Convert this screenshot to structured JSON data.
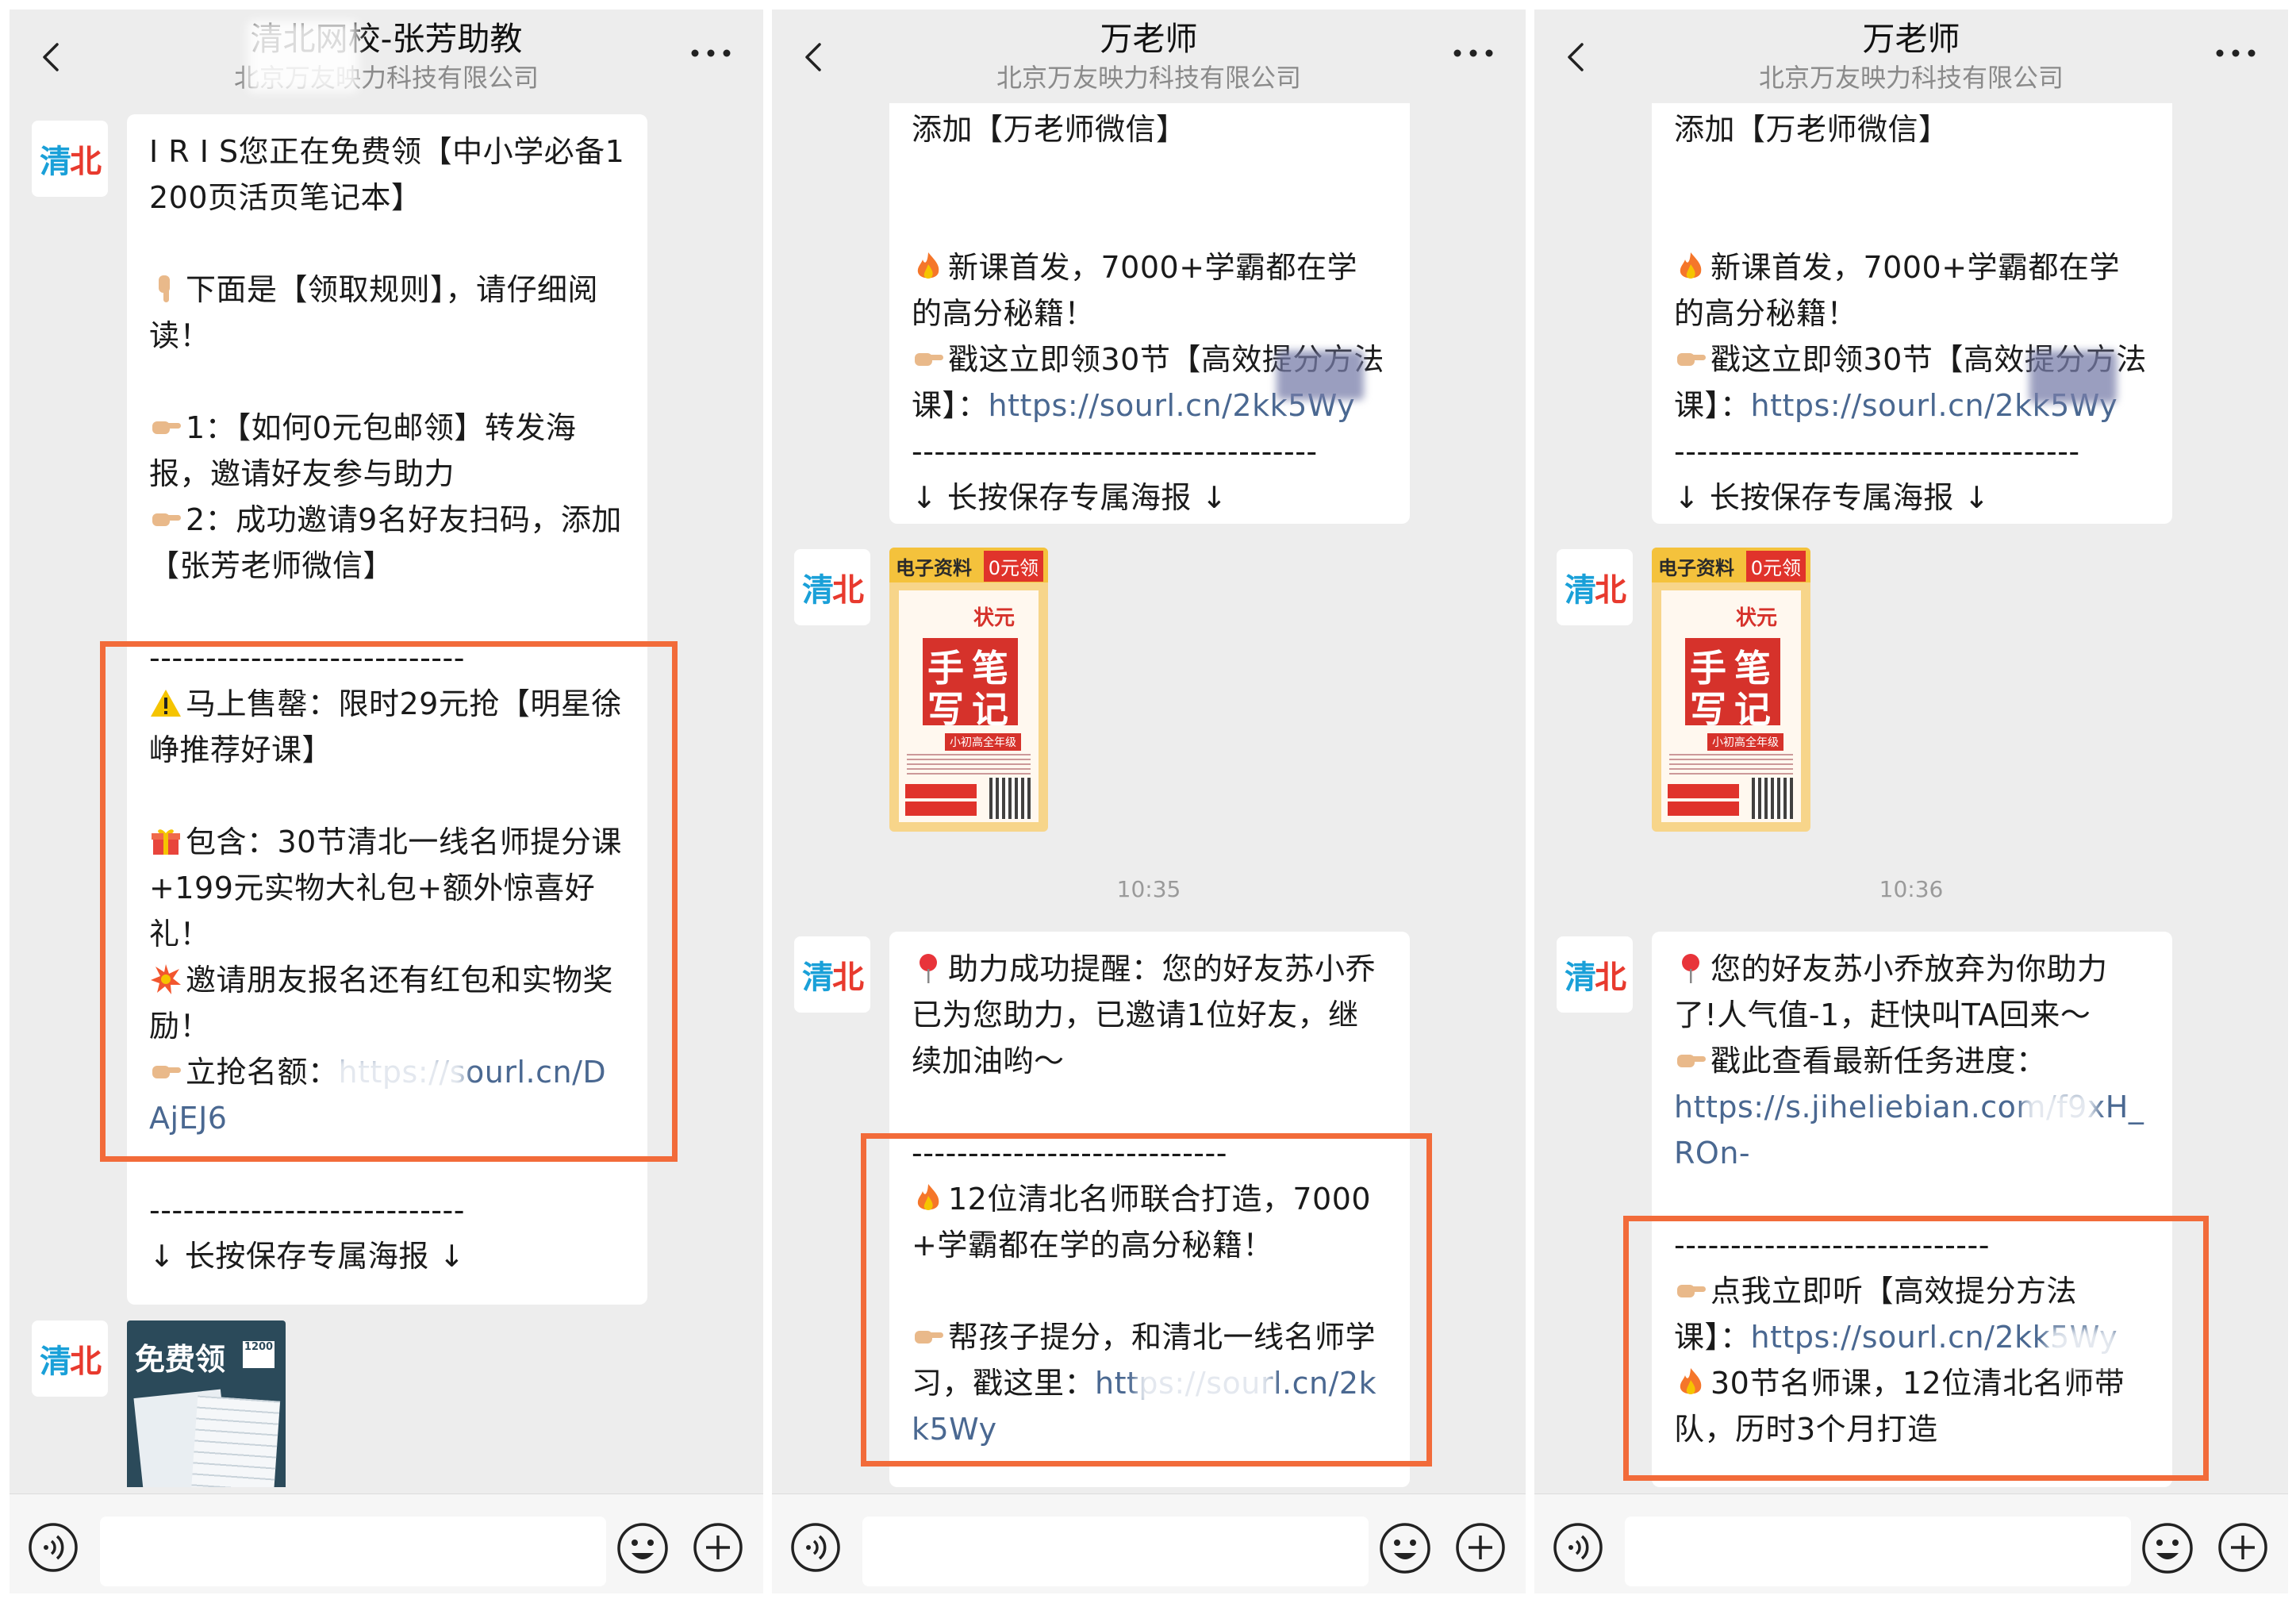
{
  "avatar": {
    "part1": "清",
    "part2": "北"
  },
  "panels": [
    {
      "title": "清北网校-张芳助教",
      "subtitle": "北京万友映力科技有限公司",
      "bubble": {
        "intro": "I R I S您正在免费领【中小学必备1200页活页笔记本】",
        "rules_line": "下面是【领取规则】，请仔细阅读！",
        "rule1": "1：【如何0元包邮领】转发海报，邀请好友参与助力",
        "rule2": "2：成功邀请9名好友扫码，添加【张芳老师微信】",
        "divider1": "----------------------------",
        "sale": "马上售罄：限时29元抢【明星徐峥推荐好课】",
        "contains": "包含：30节清北一线名师提分课+199元实物大礼包+额外惊喜好礼！",
        "invite": "邀请朋友报名还有红包和实物奖励！",
        "grab_label": "立抢名额：",
        "grab_link": "https://sourl.cn/DAjEJ6",
        "divider2": "----------------------------",
        "save_poster": "↓ 长按保存专属海报 ↓"
      },
      "notebook": {
        "title": "免费领",
        "badge": "1200"
      }
    },
    {
      "title": "万老师",
      "subtitle": "北京万友映力科技有限公司",
      "bubble_top": {
        "add_line": "添加【万老师微信】",
        "new_course": "新课首发，7000+学霸都在学的高分秘籍！",
        "claim_label": "戳这立即领30节【高效提分方法课】：",
        "claim_link": "https://sourl.cn/2kk5Wy",
        "divider": "------------------------------------",
        "save_poster": "↓ 长按保存专属海报 ↓"
      },
      "poster": {
        "top_left": "电子资料",
        "top_right": "0元领",
        "tag": "状元",
        "title1": "手",
        "title2": "笔",
        "title3": "写",
        "title4": "记",
        "grade": "小初高全年级"
      },
      "time": "10:35",
      "bubble_bottom": {
        "reminder": "助力成功提醒：您的好友苏小乔 已为您助力，已邀请1位好友，继续加油哟～",
        "divider": "----------------------------",
        "teachers": "12位清北名师联合打造，7000+学霸都在学的高分秘籍！",
        "help_label": "帮孩子提分，和清北一线名师学习，戳这里：",
        "help_link": "https://sourl.cn/2kk5Wy"
      }
    },
    {
      "title": "万老师",
      "subtitle": "北京万友映力科技有限公司",
      "bubble_top": {
        "add_line": "添加【万老师微信】",
        "new_course": "新课首发，7000+学霸都在学的高分秘籍！",
        "claim_label": "戳这立即领30节【高效提分方法课】：",
        "claim_link": "https://sourl.cn/2kk5Wy",
        "divider": "------------------------------------",
        "save_poster": "↓ 长按保存专属海报 ↓"
      },
      "poster": {
        "top_left": "电子资料",
        "top_right": "0元领",
        "tag": "状元",
        "title1": "手",
        "title2": "笔",
        "title3": "写",
        "title4": "记",
        "grade": "小初高全年级"
      },
      "time": "10:36",
      "bubble_bottom": {
        "giveup": "您的好友苏小乔放弃为你助力了!人气值-1，赶快叫TA回来～",
        "progress_label": "戳此查看最新任务进度：",
        "progress_link": "https://s.jiheliebian.com/f9xH_ROn-",
        "divider": "----------------------------",
        "listen_label": "点我立即听【高效提分方法课】：",
        "listen_link": "https://sourl.cn/2kk5Wy",
        "course_info": "30节名师课，12位清北名师带队，历时3个月打造"
      }
    }
  ]
}
